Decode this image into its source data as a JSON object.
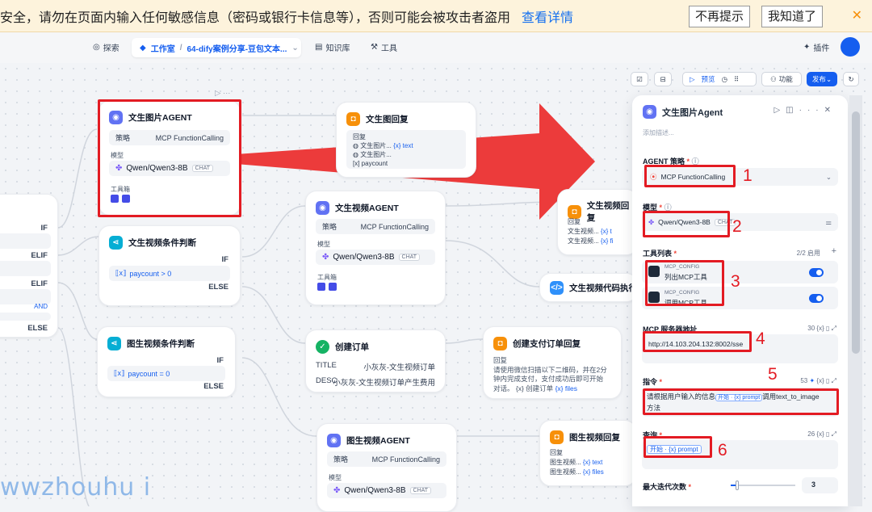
{
  "warning": {
    "text": "安全，请勿在页面内输入任何敏感信息（密码或银行卡信息等），否则可能会被攻击者盗用",
    "link": "查看详情",
    "dismiss": "不再提示",
    "ack": "我知道了",
    "close": "✕"
  },
  "topnav": {
    "explore": "探索",
    "studio": "工作室",
    "app": "64-dify案例分享-豆包文本...",
    "knowledge": "知识库",
    "tools": "工具",
    "plugins": "插件"
  },
  "toolbar": {
    "preview": "预览",
    "features": "功能",
    "publish": "发布"
  },
  "nodes": {
    "img_agent": {
      "title": "文生图片AGENT",
      "strategy_label": "策略",
      "strategy": "MCP FunctionCalling",
      "model_label": "模型",
      "model": "Qwen/Qwen3-8B",
      "chip": "CHAT",
      "tools_label": "工具箱"
    },
    "img_reply": {
      "title": "文生图回复",
      "reply_label": "回复",
      "line1": "文生图片...",
      "var1": "{x} text",
      "line2": "文生图片...",
      "line3": "paycount"
    },
    "video_agent": {
      "title": "文生视频AGENT",
      "strategy_label": "策略",
      "strategy": "MCP FunctionCalling",
      "model_label": "模型",
      "model": "Qwen/Qwen3-8B",
      "chip": "CHAT",
      "tools_label": "工具箱"
    },
    "video_reply": {
      "title": "文生视频回复",
      "reply_label": "回复",
      "line1": "文生视频...",
      "var1": "{x} t",
      "line2": "文生视频...",
      "var2": "{x} fi"
    },
    "video_code": {
      "title": "文生视频代码执行"
    },
    "video_cond": {
      "title": "文生视频条件判断",
      "if": "IF",
      "expr": "paycount > 0",
      "else": "ELSE"
    },
    "left_cond": {
      "if": "IF",
      "elif1": "ELIF",
      "elif2": "ELIF",
      "and": "AND",
      "else": "ELSE"
    },
    "i2v_cond": {
      "title": "图生视频条件判断",
      "if": "IF",
      "expr": "paycount = 0",
      "else": "ELSE"
    },
    "order": {
      "title": "创建订单",
      "k1": "TITLE",
      "v1": "小灰灰-文生视频订单",
      "k2": "DESC",
      "v2": "小灰灰-文生视频订单产生费用"
    },
    "pay_reply": {
      "title": "创建支付订单回复",
      "reply_label": "回复",
      "body1": "请使用微信扫描以下二维码，并在2分",
      "body2": "钟内完成支付，支付成功后即可开始",
      "body3": "对话。",
      "var": "{x} 创建订单",
      "var2": "{x} files"
    },
    "i2v_agent": {
      "title": "图生视频AGENT",
      "strategy_label": "策略",
      "strategy": "MCP FunctionCalling",
      "model_label": "模型",
      "model": "Qwen/Qwen3-8B",
      "chip": "CHAT"
    },
    "i2v_reply": {
      "title": "图生视频回复",
      "reply_label": "回复",
      "line1": "图生视频...",
      "var1": "{x} text",
      "line2": "图生视频...",
      "var2": "{x} files"
    }
  },
  "panel": {
    "title": "文生图片Agent",
    "desc_placeholder": "添加描述...",
    "strategy_label": "AGENT 策略",
    "strategy": "MCP FunctionCalling",
    "model_label": "模型",
    "model": "Qwen/Qwen3-8B",
    "chip": "CHAT",
    "tools_label": "工具列表",
    "tools_count": "2/2 启用",
    "tool1_provider": "MCP_CONFIG",
    "tool1_name": "列出MCP工具",
    "tool2_provider": "MCP_CONFIG",
    "tool2_name": "调用MCP工具",
    "server_label": "MCP 服务器地址",
    "server_count": "30",
    "server_url": "http://14.103.204.132:8002/sse",
    "instr_label": "指令",
    "instr_count": "53",
    "instr_text_a": "请根据用户输入的信息",
    "instr_var": "开始 · {x} prompt",
    "instr_text_b": "调用text_to_image",
    "instr_text_c": "方法",
    "query_label": "查询",
    "query_count": "26",
    "query_var": "开始 · {x} prompt",
    "iter_label": "最大迭代次数",
    "iter_value": "3"
  },
  "annotations": [
    "1",
    "2",
    "3",
    "4",
    "5",
    "6"
  ],
  "watermark": "wwzhouhu i",
  "colors": {
    "accent": "#155eef",
    "annotation": "#e31b23",
    "warning_bg": "#fdf3dc"
  }
}
